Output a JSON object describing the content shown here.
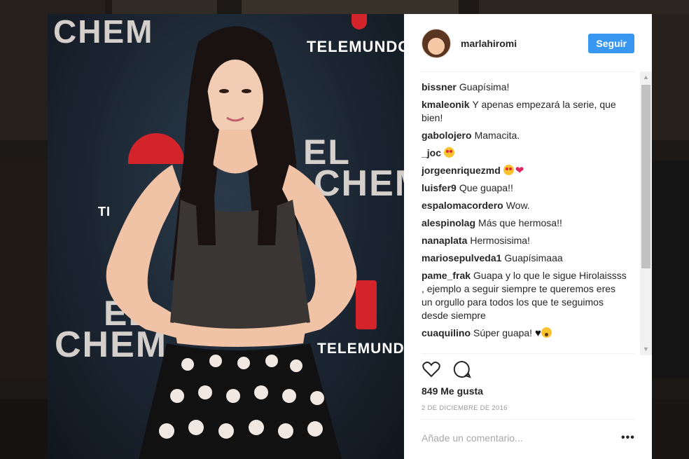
{
  "post": {
    "username": "marlahiromi",
    "follow_label": "Seguir",
    "likes": "849 Me gusta",
    "date": "2 DE DICIEMBRE DE 2016",
    "comment_placeholder": "Añade un comentario...",
    "more_label": "•••"
  },
  "photo": {
    "backdrop_texts": [
      "CHEM",
      "TELEMUNDO",
      "EL",
      "CHEM",
      "EL",
      "CHEM",
      "TELEMUNDO",
      "TI"
    ]
  },
  "comments": [
    {
      "user": "bissner",
      "text": "Guapísima!"
    },
    {
      "user": "kmaleonik",
      "text": "Y apenas empezará la serie, que bien!"
    },
    {
      "user": "gabolojero",
      "text": "Mamacita."
    },
    {
      "user": "_joc",
      "text": "",
      "emojis": [
        "heart-eyes-emoji"
      ]
    },
    {
      "user": "jorgeenriquezmd",
      "text": "",
      "emojis": [
        "heart-eyes-emoji",
        "red-heart-emoji"
      ]
    },
    {
      "user": "luisfer9",
      "text": "Que guapa!!"
    },
    {
      "user": "espalomacordero",
      "text": "Wow."
    },
    {
      "user": "alespinolag",
      "text": "Más que hermosa!!"
    },
    {
      "user": "nanaplata",
      "text": "Hermosisima!"
    },
    {
      "user": "mariosepulveda1",
      "text": "Guapísimaaa"
    },
    {
      "user": "pame_frak",
      "text": "Guapa y lo que le sigue Hirolaissss , ejemplo a seguir siempre te queremos eres un orgullo para todos los que te seguimos desde siempre"
    },
    {
      "user": "cuaquilino",
      "text": "Súper guapa!",
      "emojis": [
        "black-heart-emoji",
        "wow-emoji"
      ]
    }
  ],
  "colors": {
    "accent": "#3897f0",
    "text": "#262626",
    "muted": "#999999",
    "telemundo_red": "#d3242c"
  },
  "icons": [
    "like-heart-icon",
    "comment-bubble-icon",
    "scroll-up-arrow-icon",
    "scroll-down-arrow-icon"
  ]
}
